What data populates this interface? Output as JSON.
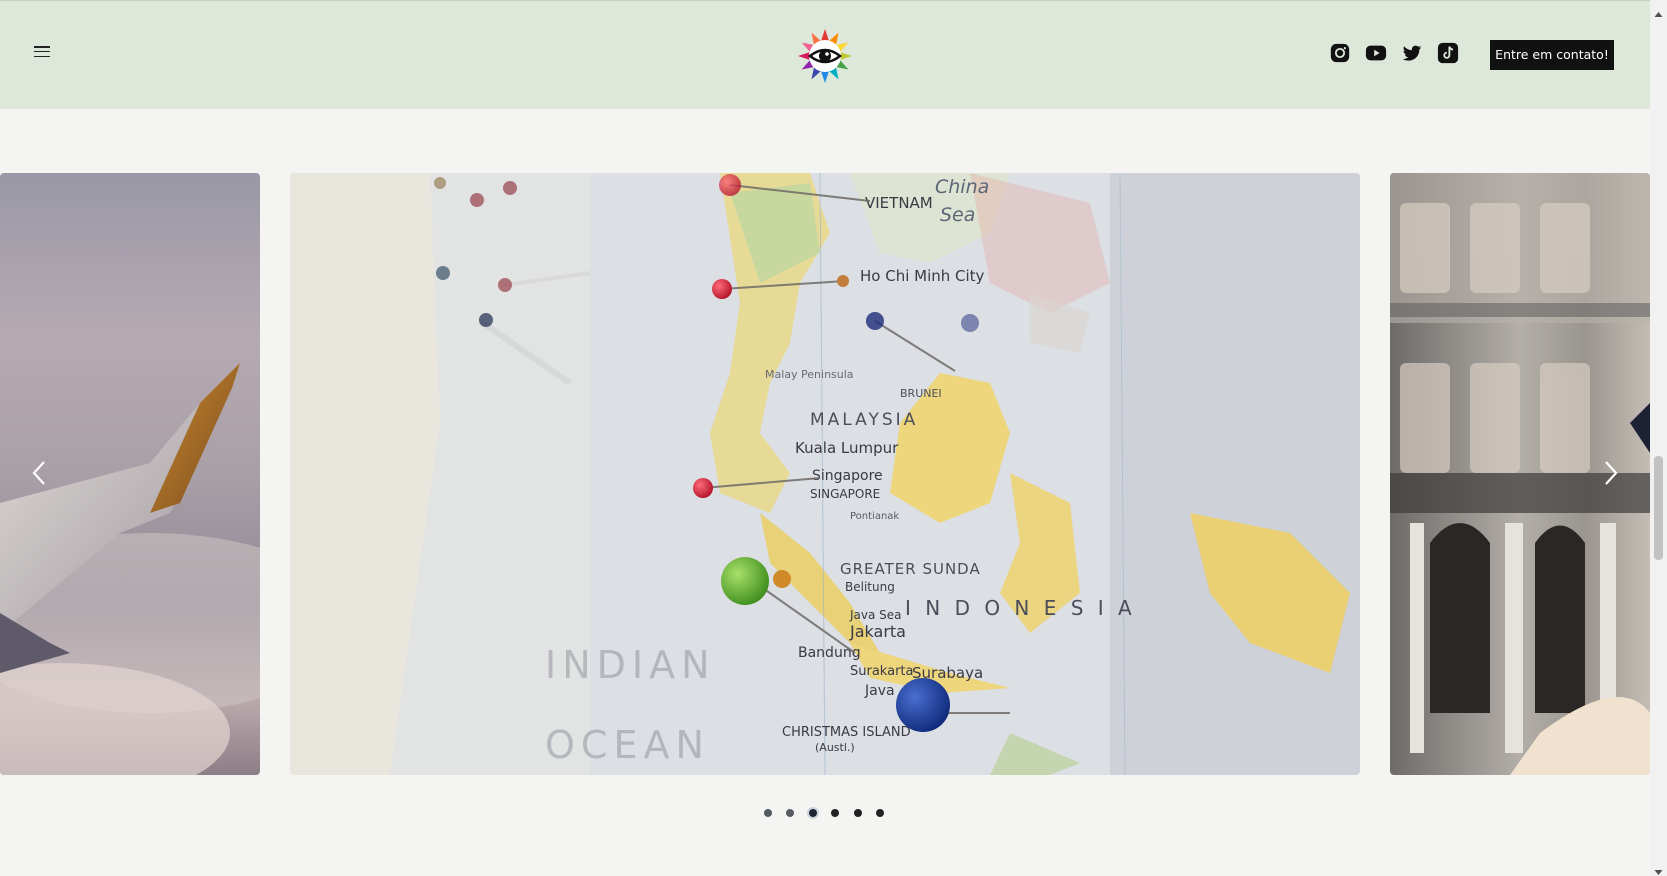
{
  "header": {
    "menu_icon": "hamburger-menu-icon",
    "logo_icon": "rainbow-eye-logo",
    "social": [
      {
        "name": "Instagram",
        "icon": "instagram-icon"
      },
      {
        "name": "YouTube",
        "icon": "youtube-icon"
      },
      {
        "name": "Twitter",
        "icon": "twitter-icon"
      },
      {
        "name": "TikTok",
        "icon": "tiktok-icon"
      }
    ],
    "cta_label": "Entre em contato!",
    "background": "#dde8da"
  },
  "carousel": {
    "slides": [
      "airplane-wing",
      "map-pins",
      "building-facade"
    ],
    "active_slide": 3,
    "total_slides": 6,
    "prev_icon": "chevron-left-icon",
    "next_icon": "chevron-right-icon",
    "map_labels": {
      "vietnam": "VIETNAM",
      "china": "China",
      "sea": "Sea",
      "hcm": "Ho Chi Minh City",
      "malaysia": "MALAYSIA",
      "kuala": "Kuala Lumpur",
      "singapore": "Singapore",
      "singapore_caps": "SINGAPORE",
      "greater_sunda": "GREATER SUNDA",
      "indonesia": "I N D O N E S I A",
      "jakarta": "Jakarta",
      "bandung": "Bandung",
      "surabaya": "Surabaya",
      "java": "Java",
      "java_sea": "Java Sea",
      "christmas": "CHRISTMAS ISLAND",
      "austl": "(Austl.)",
      "indian": "INDIAN",
      "ocean": "OCEAN",
      "brunei": "BRUNEI",
      "peninsula": "Malay Peninsula",
      "pontianak": "Pontianak",
      "belitung": "Belitung"
    }
  },
  "scrollbar": {
    "up_icon": "scroll-up-arrow-icon",
    "down_icon": "scroll-down-arrow-icon"
  }
}
